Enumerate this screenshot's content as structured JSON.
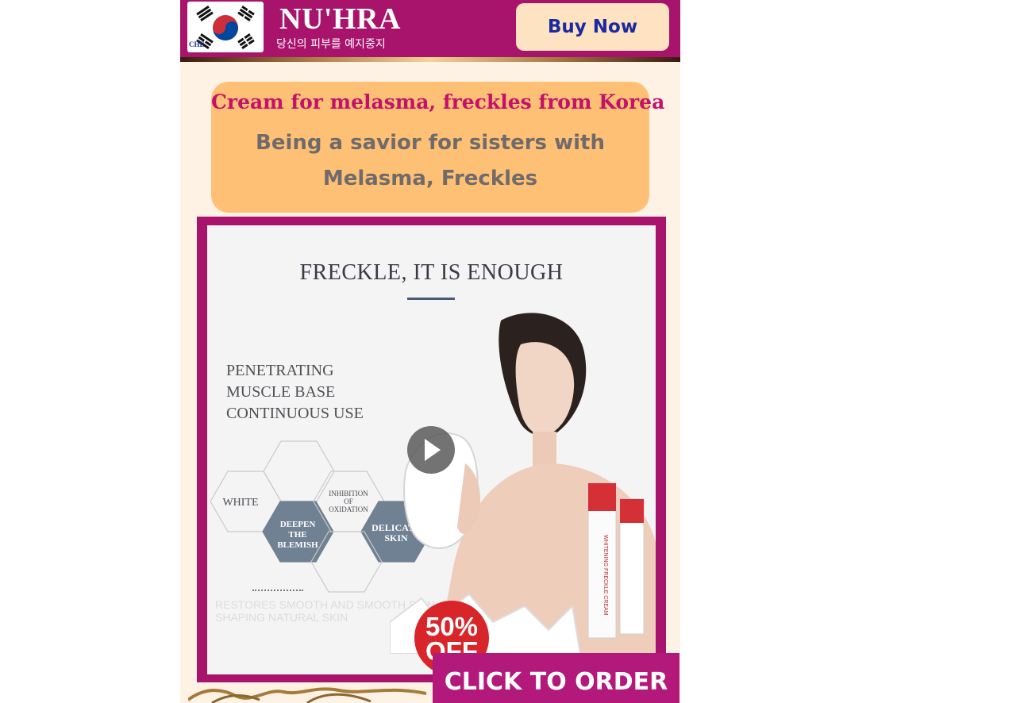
{
  "header": {
    "brand": "NU'HRA",
    "tagline": "당신의 피부를 예지중지",
    "flag_tag": "CHE",
    "flag_icon": "south-korea-flag-icon",
    "buy_button_label": "Buy Now",
    "colors": {
      "bar": "#a8136b",
      "button_bg": "#fde3c2",
      "button_text": "#1b2a9c"
    }
  },
  "headline": {
    "title": "Cream for melasma, freckles from Korea",
    "subtitle_line1": "Being a savior for sisters with",
    "subtitle_line2": "Melasma, Freckles",
    "colors": {
      "card": "#fec075",
      "title": "#c4116a",
      "subtitle": "#706b6a"
    }
  },
  "video": {
    "title": "FRECKLE, IT IS ENOUGH",
    "features": [
      "PENETRATING",
      "MUSCLE BASE",
      "CONTINUOUS USE"
    ],
    "hexagons": [
      {
        "label": [
          "WHITE"
        ]
      },
      {
        "label": [
          "DEEPEN",
          "THE",
          "BLEMISH"
        ]
      },
      {
        "label": [
          "INHIBITION",
          "OF",
          "OXIDATION"
        ]
      },
      {
        "label": [
          "DELICATE",
          "SKIN"
        ]
      }
    ],
    "faded_text": [
      "RESTORES SMOOTH AND SMOOTH SKIN",
      "SHAPING NATURAL SKIN"
    ],
    "product_label": "WHITENING FRECKLE CREAM",
    "play_icon": "play-icon"
  },
  "promo": {
    "badge_percent": "50%",
    "badge_off": "OFF",
    "order_button_label": "CLICK TO ORDER",
    "colors": {
      "badge": "#d8252a",
      "order_bg": "#b3197a"
    }
  }
}
